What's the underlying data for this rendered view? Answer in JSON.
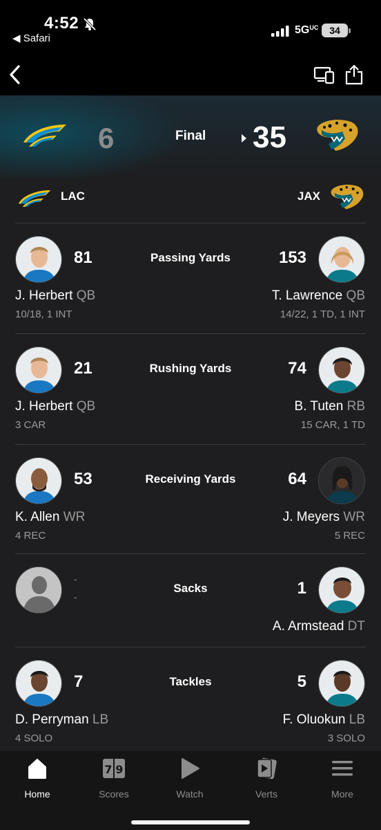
{
  "status_bar": {
    "time": "4:52",
    "back_app": "◀ Safari",
    "network": "5G",
    "network_suffix": "UC",
    "battery": "34"
  },
  "game": {
    "away": {
      "abbr": "LAC",
      "score": "6"
    },
    "home": {
      "abbr": "JAX",
      "score": "35"
    },
    "status": "Final"
  },
  "leaders": [
    {
      "category": "Passing Yards",
      "left": {
        "value": "81",
        "name": "J. Herbert",
        "pos": "QB",
        "line": "10/18, 1 INT"
      },
      "right": {
        "value": "153",
        "name": "T. Lawrence",
        "pos": "QB",
        "line": "14/22, 1 TD, 1 INT"
      }
    },
    {
      "category": "Rushing Yards",
      "left": {
        "value": "21",
        "name": "J. Herbert",
        "pos": "QB",
        "line": "3 CAR"
      },
      "right": {
        "value": "74",
        "name": "B. Tuten",
        "pos": "RB",
        "line": "15 CAR, 1 TD"
      }
    },
    {
      "category": "Receiving Yards",
      "left": {
        "value": "53",
        "name": "K. Allen",
        "pos": "WR",
        "line": "4 REC"
      },
      "right": {
        "value": "64",
        "name": "J. Meyers",
        "pos": "WR",
        "line": "5 REC"
      }
    },
    {
      "category": "Sacks",
      "left": {
        "value1": "-",
        "value2": "-"
      },
      "right": {
        "value": "1",
        "name": "A. Armstead",
        "pos": "DT"
      }
    },
    {
      "category": "Tackles",
      "left": {
        "value": "7",
        "name": "D. Perryman",
        "pos": "LB",
        "line": "4 SOLO"
      },
      "right": {
        "value": "5",
        "name": "F. Oluokun",
        "pos": "LB",
        "line": "3 SOLO"
      }
    }
  ],
  "tabs": [
    {
      "label": "Home",
      "icon": "home-icon",
      "active": true
    },
    {
      "label": "Scores",
      "icon": "scoreboard-icon"
    },
    {
      "label": "Watch",
      "icon": "play-icon"
    },
    {
      "label": "Verts",
      "icon": "verts-icon"
    },
    {
      "label": "More",
      "icon": "menu-icon"
    }
  ],
  "colors": {
    "background": "#1e1e20",
    "chargers_blue": "#0a8fd8",
    "chargers_gold": "#f6c50f",
    "jaguars_teal": "#006778",
    "jaguars_gold": "#d7a22a"
  }
}
